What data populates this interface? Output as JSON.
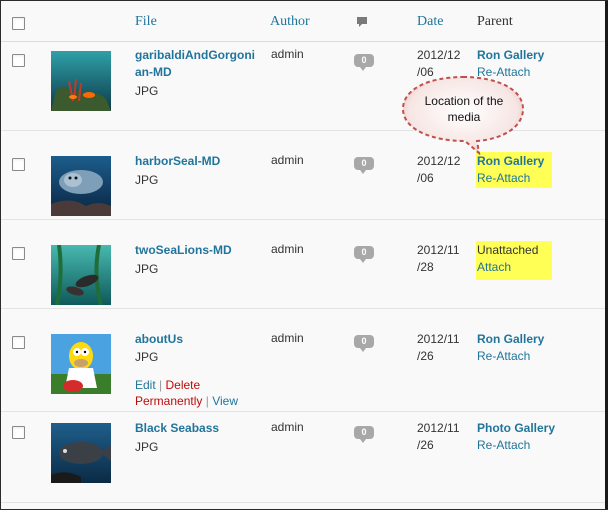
{
  "header": {
    "file": "File",
    "author": "Author",
    "date": "Date",
    "parent": "Parent"
  },
  "rows": [
    {
      "file": "garibaldiAndGorgonian-MD",
      "file_line1": "garibaldiAndGorgoni",
      "file_line2": "an-MD",
      "type": "JPG",
      "author": "admin",
      "comments": "0",
      "date_line1": "2012/12",
      "date_line2": "/06",
      "parent": "Ron Gallery",
      "parent_action": "Re-Attach",
      "thumb": "underwater-reef-orange-fish"
    },
    {
      "file": "harborSeal-MD",
      "type": "JPG",
      "author": "admin",
      "comments": "0",
      "date_line1": "2012/12",
      "date_line2": "/06",
      "parent": "Ron Gallery",
      "parent_action": "Re-Attach",
      "thumb": "harbor-seal-blue"
    },
    {
      "file": "twoSeaLions-MD",
      "type": "JPG",
      "author": "admin",
      "comments": "0",
      "date_line1": "2012/11",
      "date_line2": "/28",
      "parent": "Unattached",
      "parent_action": "Attach",
      "thumb": "sea-lions-kelp"
    },
    {
      "file": "aboutUs",
      "type": "JPG",
      "author": "admin",
      "comments": "0",
      "date_line1": "2012/11",
      "date_line2": "/26",
      "parent": "Ron Gallery",
      "parent_action": "Re-Attach",
      "thumb": "cartoon-character",
      "actions": {
        "edit": "Edit",
        "delete": "Delete",
        "permanently": "Permanently",
        "view": "View",
        "sep": "|"
      }
    },
    {
      "file": "Black Seabass",
      "type": "JPG",
      "author": "admin",
      "comments": "0",
      "date_line1": "2012/11",
      "date_line2": "/26",
      "parent": "Photo Gallery",
      "parent_action": "Re-Attach",
      "thumb": "black-seabass"
    }
  ],
  "callout": {
    "text": "Location of the media"
  },
  "colors": {
    "link": "#21759b",
    "delete": "#bc0b0b",
    "highlight": "#ffff55",
    "callout_border": "#c0504d"
  }
}
